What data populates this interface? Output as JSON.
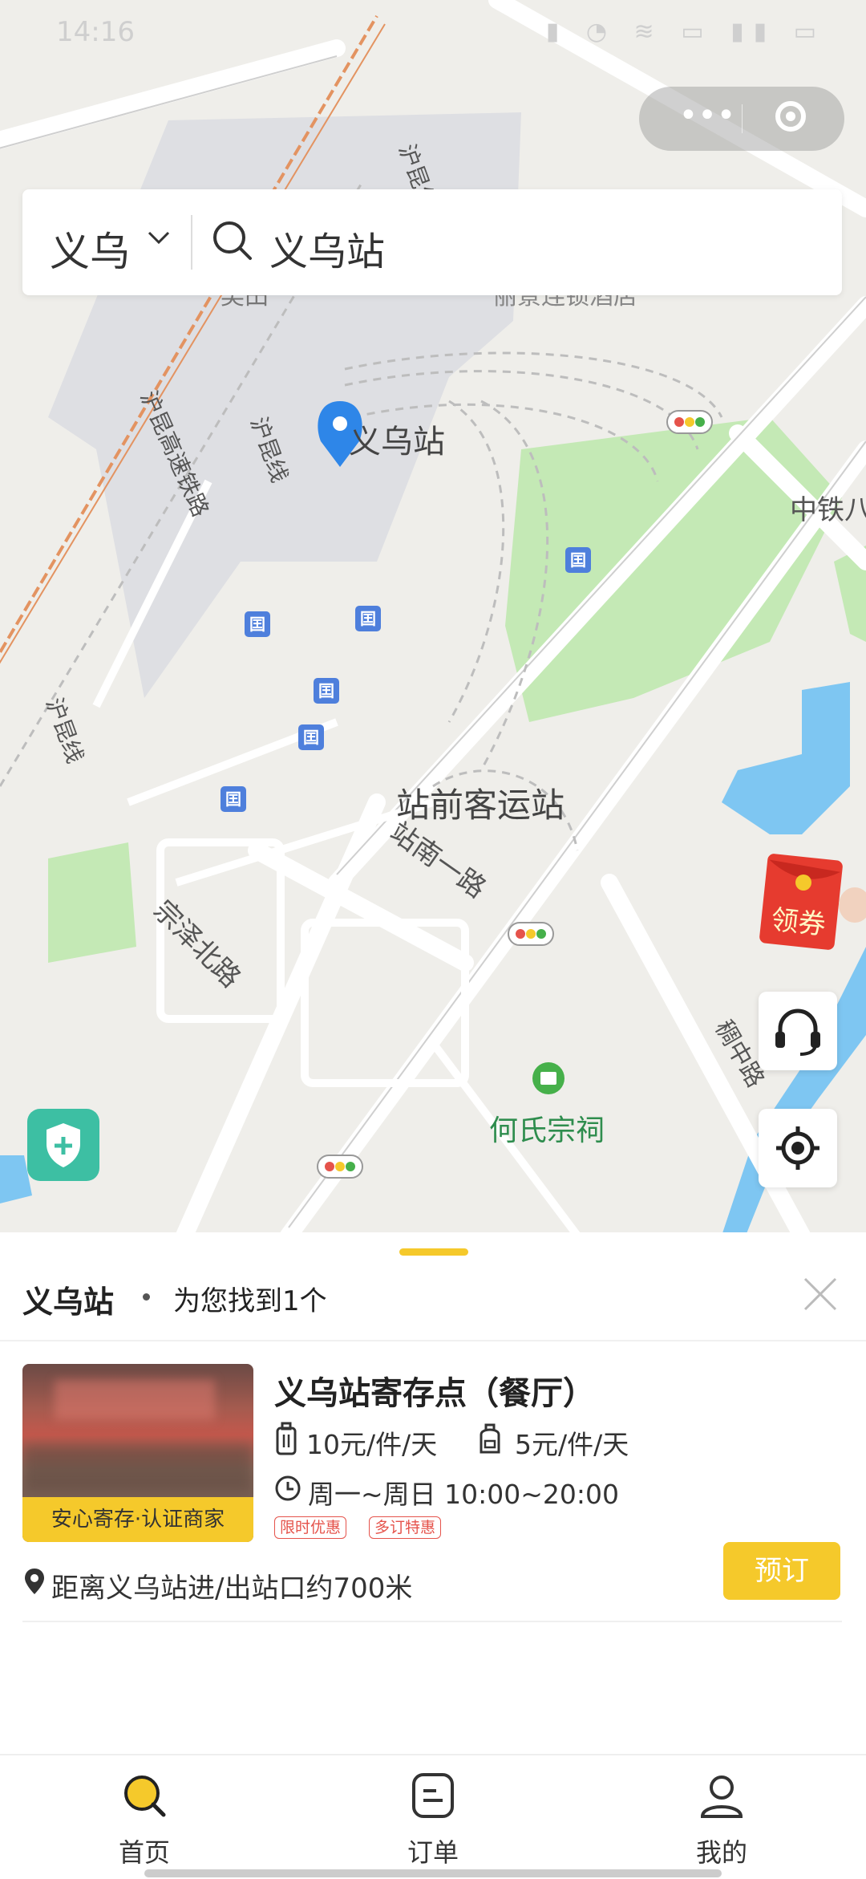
{
  "status_bar": {
    "time": "14:16"
  },
  "search": {
    "city": "义乌",
    "query": "义乌站"
  },
  "map": {
    "labels": {
      "station": "义乌站",
      "huangkun_line_1": "沪昆线",
      "huangkun_line_2": "沪昆线",
      "huangkun_hsr": "沪昆高速铁路",
      "zhanqian_bus": "站前客运站",
      "zhannan_road": "站南一路",
      "zongze_road": "宗泽北路",
      "hecun_temple": "何氏宗祠",
      "zhongtie": "中铁八",
      "chouzhong_road": "稠中路",
      "kuntian": "吴田",
      "hotel": "丽景连锁酒店",
      "huangkun_line_3": "沪昆线"
    },
    "coupon_label": "领券"
  },
  "results": {
    "title": "义乌站",
    "count_text": "为您找到1个",
    "stores": [
      {
        "name": "义乌站寄存点（餐厅）",
        "badge": "安心寄存·认证商家",
        "price_large": "10元/件/天",
        "price_small": "5元/件/天",
        "hours": "周一~周日 10:00~20:00",
        "tags": [
          "限时优惠",
          "多订特惠"
        ],
        "distance": "距离义乌站进/出站口约700米",
        "book_label": "预订"
      }
    ]
  },
  "tabbar": {
    "items": [
      {
        "label": "首页",
        "icon": "search-icon",
        "active": true
      },
      {
        "label": "订单",
        "icon": "order-icon",
        "active": false
      },
      {
        "label": "我的",
        "icon": "profile-icon",
        "active": false
      }
    ]
  },
  "colors": {
    "accent": "#f5c92b",
    "tag_red": "#e5534b",
    "map_bg": "#efeeea",
    "water": "#7ec6f2",
    "green": "#c4e9b5"
  }
}
